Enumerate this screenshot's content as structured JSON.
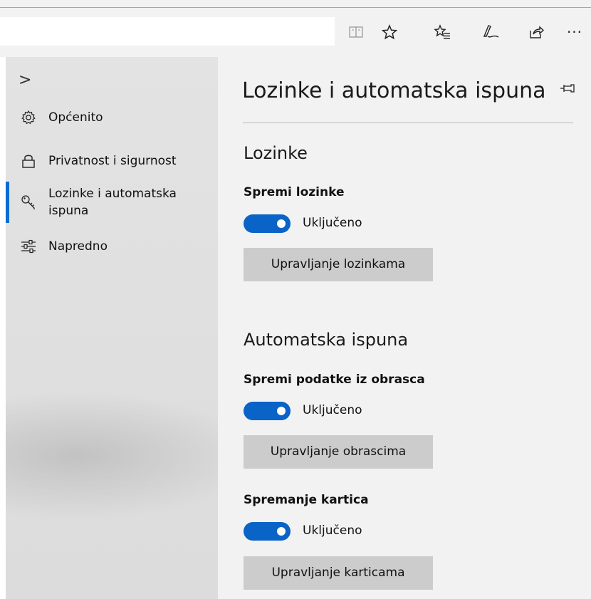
{
  "toolbar": {
    "icons": [
      "reading-view-icon",
      "favorite-star-icon",
      "favorites-list-icon",
      "pen-icon",
      "share-icon",
      "more-icon"
    ],
    "more_label": "···"
  },
  "sidebar": {
    "expand_glyph": ">",
    "items": [
      {
        "label": "Općenito",
        "icon": "gear-icon"
      },
      {
        "label": "Privatnost i sigurnost",
        "icon": "lock-icon"
      },
      {
        "label_line1": "Lozinke i automatska",
        "label_line2": "ispuna",
        "icon": "key-icon",
        "active": true
      },
      {
        "label": "Napredno",
        "icon": "sliders-icon"
      }
    ],
    "accent": "#0a6cd1"
  },
  "panel": {
    "title": "Lozinke i automatska ispuna",
    "sections": [
      {
        "heading": "Lozinke",
        "settings": [
          {
            "label": "Spremi lozinke",
            "state": "Uključeno",
            "on": true,
            "button": "Upravljanje lozinkama"
          }
        ]
      },
      {
        "heading": "Automatska ispuna",
        "settings": [
          {
            "label": "Spremi podatke iz obrasca",
            "state": "Uključeno",
            "on": true,
            "button": "Upravljanje obrascima"
          },
          {
            "label": "Spremanje kartica",
            "state": "Uključeno",
            "on": true,
            "button": "Upravljanje karticama"
          }
        ]
      }
    ],
    "toggle_color": "#0a63c6"
  }
}
